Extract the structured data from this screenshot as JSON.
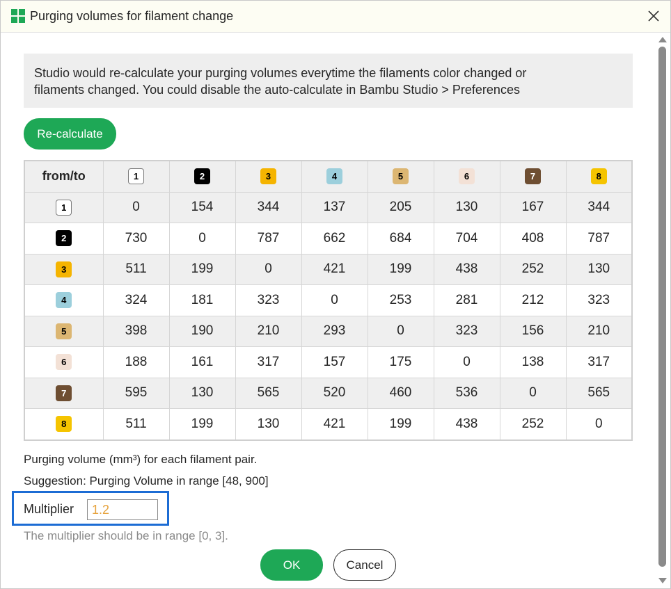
{
  "window": {
    "title": "Purging volumes for filament change"
  },
  "notice": {
    "line1": "Studio would re-calculate your purging volumes everytime the filaments color changed or",
    "line2": "filaments changed. You could disable the auto-calculate in Bambu Studio > Preferences"
  },
  "recalculate_label": "Re-calculate",
  "table": {
    "corner": "from/to",
    "filaments": [
      {
        "label": "1",
        "color": "#ffffff",
        "text_color": "#000000",
        "border": "#7a7a7a"
      },
      {
        "label": "2",
        "color": "#000000",
        "text_color": "#ffffff",
        "border": "#000000"
      },
      {
        "label": "3",
        "color": "#f5b400",
        "text_color": "#000000",
        "border": "#f5b400"
      },
      {
        "label": "4",
        "color": "#9ccfdc",
        "text_color": "#000000",
        "border": "#9ccfdc"
      },
      {
        "label": "5",
        "color": "#dcb672",
        "text_color": "#000000",
        "border": "#dcb672"
      },
      {
        "label": "6",
        "color": "#f3e1d6",
        "text_color": "#000000",
        "border": "#f3e1d6"
      },
      {
        "label": "7",
        "color": "#6e4e32",
        "text_color": "#ffffff",
        "border": "#6e4e32"
      },
      {
        "label": "8",
        "color": "#f5c400",
        "text_color": "#000000",
        "border": "#f5c400"
      }
    ],
    "rows": [
      [
        "0",
        "154",
        "344",
        "137",
        "205",
        "130",
        "167",
        "344"
      ],
      [
        "730",
        "0",
        "787",
        "662",
        "684",
        "704",
        "408",
        "787"
      ],
      [
        "511",
        "199",
        "0",
        "421",
        "199",
        "438",
        "252",
        "130"
      ],
      [
        "324",
        "181",
        "323",
        "0",
        "253",
        "281",
        "212",
        "323"
      ],
      [
        "398",
        "190",
        "210",
        "293",
        "0",
        "323",
        "156",
        "210"
      ],
      [
        "188",
        "161",
        "317",
        "157",
        "175",
        "0",
        "138",
        "317"
      ],
      [
        "595",
        "130",
        "565",
        "520",
        "460",
        "536",
        "0",
        "565"
      ],
      [
        "511",
        "199",
        "130",
        "421",
        "199",
        "438",
        "252",
        "0"
      ]
    ]
  },
  "captions": {
    "unit": "Purging volume (mm³) for each filament pair.",
    "suggestion": "Suggestion: Purging Volume in range [48, 900]"
  },
  "multiplier": {
    "label": "Multiplier",
    "value": "1.2",
    "hint": "The multiplier should be in range [0, 3]."
  },
  "buttons": {
    "ok": "OK",
    "cancel": "Cancel"
  },
  "colors": {
    "accent_green": "#1ea856",
    "highlight_blue": "#1c6cd4",
    "multiplier_value": "#e6a23c"
  }
}
